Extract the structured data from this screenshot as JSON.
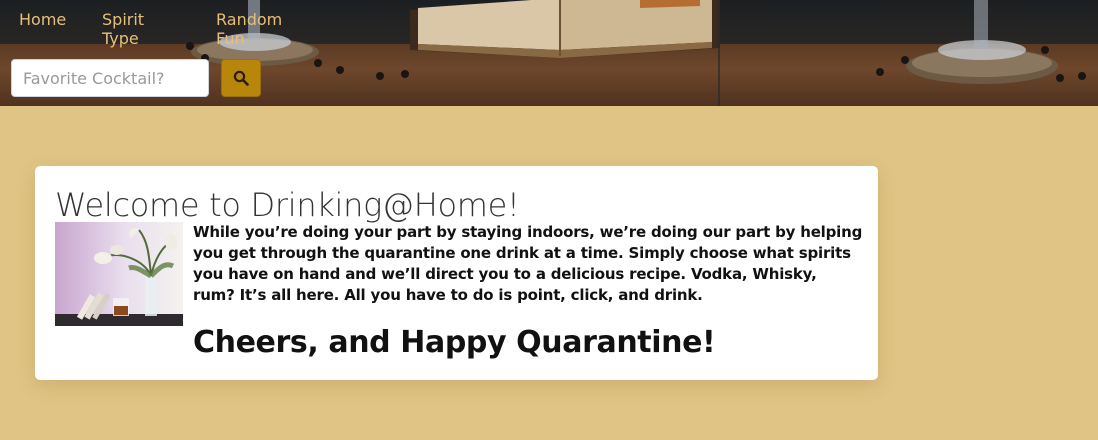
{
  "nav": {
    "items": [
      {
        "label": "Home"
      },
      {
        "label": "Spirit Type"
      },
      {
        "label": "Random Fun"
      }
    ]
  },
  "search": {
    "placeholder": "Favorite Cocktail?",
    "value": "",
    "button_icon": "search-icon"
  },
  "welcome": {
    "title": "Welcome to Drinking@Home!",
    "image_icon": "cocktail-flowers-photo",
    "body": "While you’re doing your part by staying indoors, we’re doing our part by helping you get through the quarantine one drink at a time. Simply choose what spirits you have on hand and we’ll direct you to a delicious recipe. Vodka, Whisky, rum? It’s all here. All you have to do is point, click, and drink.",
    "closing": "Cheers, and Happy Quarantine!"
  },
  "colors": {
    "page_background": "#e0c485",
    "nav_text": "#e7bf7a",
    "search_button": "#b8860b",
    "card_background": "#ffffff"
  }
}
